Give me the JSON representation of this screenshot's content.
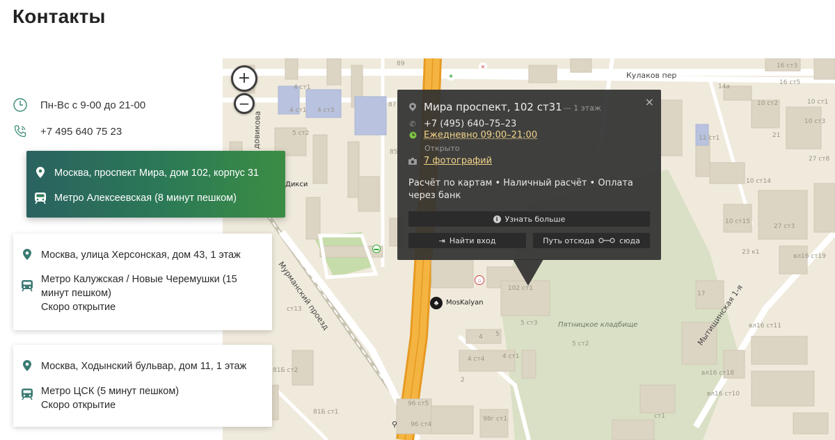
{
  "page": {
    "title": "Контакты"
  },
  "contacts": {
    "hours": "Пн-Вс с 9-00 до 21-00",
    "phone": "+7 495 640 75 23"
  },
  "locations": [
    {
      "address": "Москва, проспект Мира, дом 102, корпус 31",
      "metro": "Метро Алексеевская (8 минут пешком)",
      "note": ""
    },
    {
      "address": "Москва, улица Херсонская, дом 43, 1 этаж",
      "metro": "Метро Калужская / Новые Черемушки (15 минут пешком)",
      "metro_line1": "Метро Калужская / Новые Черемушки (15",
      "metro_line2": "минут пешком)",
      "note": "Скоро открытие"
    },
    {
      "address": "Москва, Ходынский бульвар, дом 11, 1 этаж",
      "metro": "Метро ЦСК (5 минут пешком)",
      "note": "Скоро открытие"
    }
  ],
  "map": {
    "zoom_in": "+",
    "zoom_out": "−",
    "balloon": {
      "title": "Мира проспект, 102 ст31",
      "floor": "— 1 этаж",
      "phone": "+7 (495) 640–75–23",
      "hours": "Ежедневно 09:00–21:00",
      "status": "Открыто",
      "photos": "7 фотографий",
      "payment": "Расчёт по картам • Наличный расчёт • Оплата через банк",
      "more_button": "Узнать больше",
      "entrance_button": "Найти вход",
      "route_from": "Путь отсюда",
      "route_to": "сюда",
      "close": "×"
    },
    "labels": {
      "street_kulakov": "Кулаков пер",
      "street_murmansky": "Мурманский проезд",
      "street_mytishchinskaya": "Мытищинская 1-я",
      "street_bogorodsky": "довикова",
      "cemetery": "Пятницкое кладбище",
      "poi_moskalyan": "MosKalyan",
      "poi_diksi": "Дикси",
      "b1": "4 ст1",
      "b2": "4 ст3",
      "b3": "4 ст1",
      "b4": "5 ст2",
      "b5": "89",
      "b6": "87",
      "b7": "85",
      "b8": "102 ст1",
      "b9": "5 ст3",
      "b10": "5 ст2",
      "b11": "4 ст4",
      "b12": "4 ст1",
      "b13": "96 ст5",
      "b14": "96 ст4",
      "b15": "98г ст1",
      "b16": "16 ст3",
      "b17": "10 ст2",
      "b18": "10 ст3",
      "b19": "12 ст1",
      "b20": "27 ст8",
      "b21": "10 ст14",
      "b22": "10 ст15",
      "b23": "27 ст3",
      "b24": "23 к1",
      "b25": "вл16 ст19",
      "b26": "17",
      "b27": "вл16 ст11",
      "b28": "вл16 ст18",
      "b29": "вл16 ст10",
      "b30": "ст13",
      "b31": "81Б ст2",
      "b32": "81Б ст1",
      "b33": "14а",
      "b34": "4",
      "b35": "5",
      "b36": "2",
      "b37": "16 ст5",
      "b38": "10 ст1",
      "b39": "21",
      "b40": "ст1"
    }
  },
  "colors": {
    "active_card_start": "#2a6260",
    "active_card_end": "#3b8d44",
    "icon_teal": "#3a7a72",
    "map_bg": "#efeadc",
    "road_orange": "#f0a830",
    "balloon_bg": "#323232",
    "link_yellow": "#f3d58a"
  }
}
